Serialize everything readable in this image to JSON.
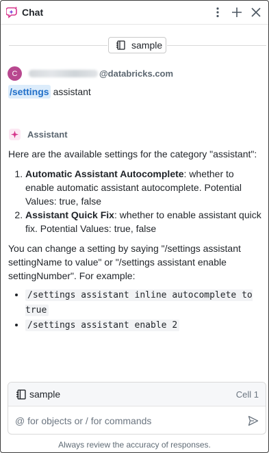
{
  "header": {
    "title": "Chat",
    "icons": [
      "assistant-chat-logo-icon",
      "more-vertical-icon",
      "plus-icon",
      "close-icon"
    ]
  },
  "context_chip": {
    "label": "sample",
    "icon": "notebook-icon"
  },
  "user_message": {
    "avatar_initial": "C",
    "email_visible": "@databricks.com",
    "command": "/settings",
    "text": "assistant"
  },
  "assistant": {
    "name": "Assistant",
    "intro": "Here are the available settings for the category \"assistant\":",
    "settings": [
      {
        "name": "Automatic Assistant Autocomplete",
        "description": ": whether to enable automatic assistant autocomplete. Potential Values: true, false"
      },
      {
        "name": "Assistant Quick Fix",
        "description": ": whether to enable assistant quick fix. Potential Values: true, false"
      }
    ],
    "outro": "You can change a setting by saying \"/settings assistant settingName to value\" or \"/settings assistant enable settingNumber\". For example:",
    "examples": [
      "/settings assistant inline autocomplete to true",
      "/settings assistant enable 2"
    ]
  },
  "composer": {
    "context_name": "sample",
    "context_cell": "Cell 1",
    "placeholder": "@ for objects or / for commands",
    "value": ""
  },
  "footer_note": "Always review the accuracy of responses.",
  "colors": {
    "accent_blue": "#2270c9",
    "command_bg": "#dcecfb",
    "avatar": "#b8488f",
    "assistant_pink": "#d6338a"
  }
}
